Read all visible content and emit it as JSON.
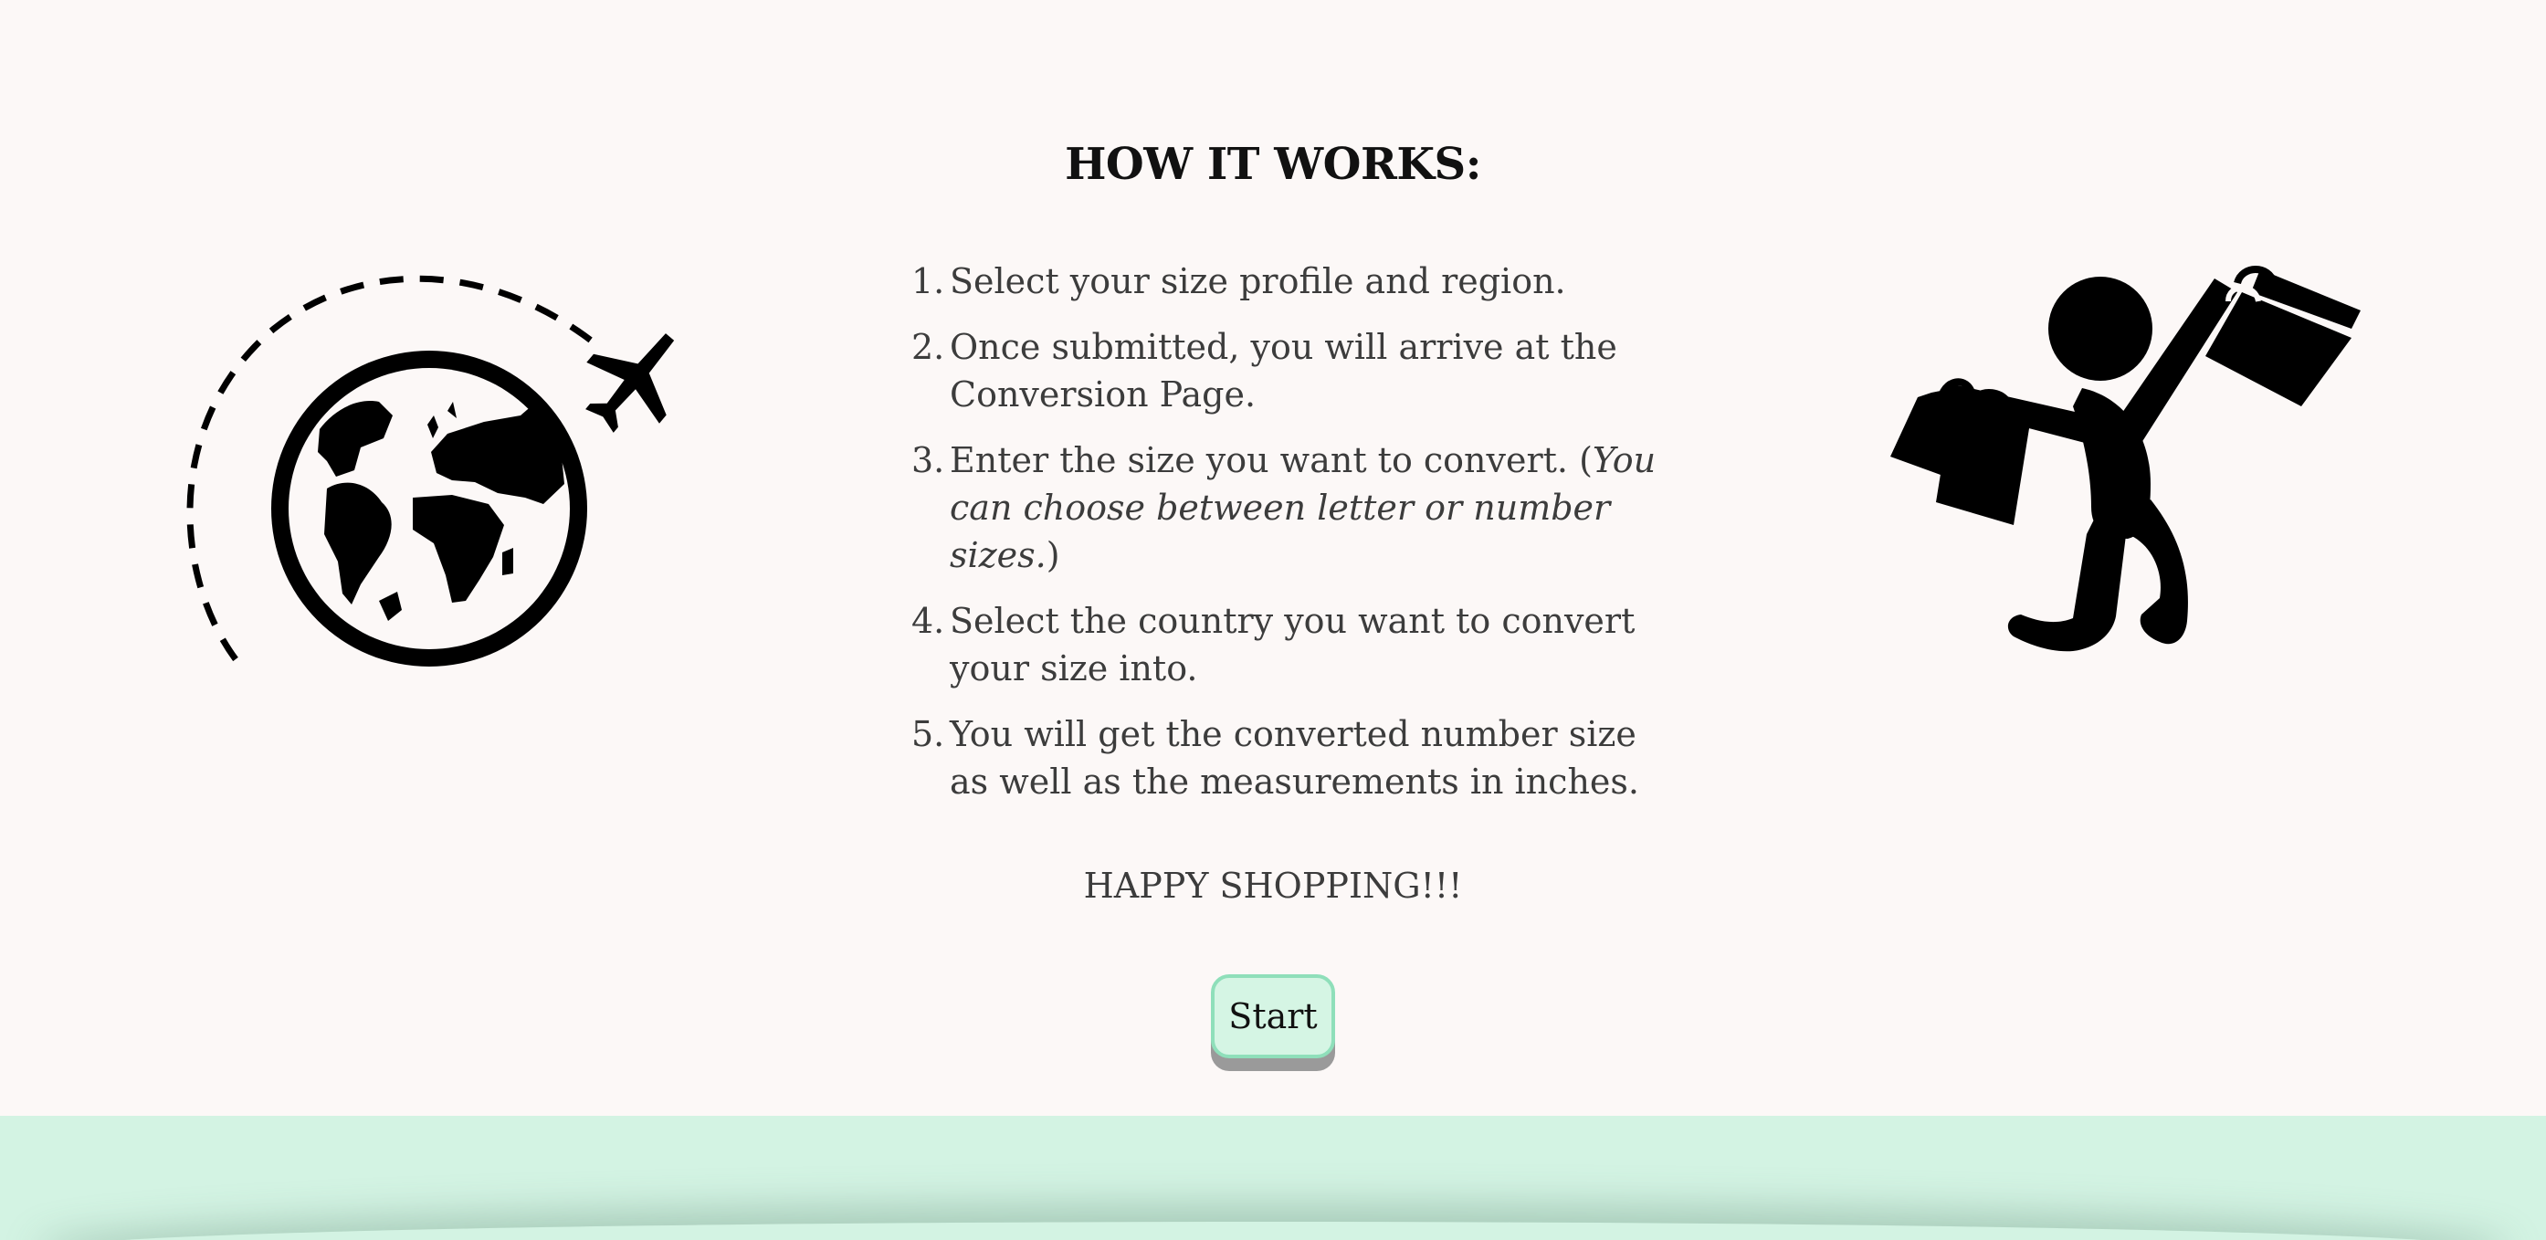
{
  "page": {
    "title": "HOW IT WORKS:",
    "closing": "HAPPY SHOPPING!!!"
  },
  "steps": [
    {
      "num": "1.",
      "text": "Select your size profile and region.",
      "note": ""
    },
    {
      "num": "2.",
      "text": "Once submitted, you will arrive at the Conversion Page.",
      "note": ""
    },
    {
      "num": "3.",
      "text": "Enter the size you want to convert. (",
      "note": "You can choose between letter or number sizes.",
      "after": ")"
    },
    {
      "num": "4.",
      "text": "Select the country you want to convert your size into.",
      "note": ""
    },
    {
      "num": "5.",
      "text": "You will get the converted number size as well as the measurements in inches.",
      "note": ""
    }
  ],
  "start_button": {
    "label": "Start"
  },
  "illustrations": {
    "left": "globe-airplane-icon",
    "right": "shopper-bags-icon"
  },
  "colors": {
    "background": "#fcf8f7",
    "accent": "#d3f3e3",
    "button_border": "#8fdfba",
    "text": "#3c3c3c"
  }
}
